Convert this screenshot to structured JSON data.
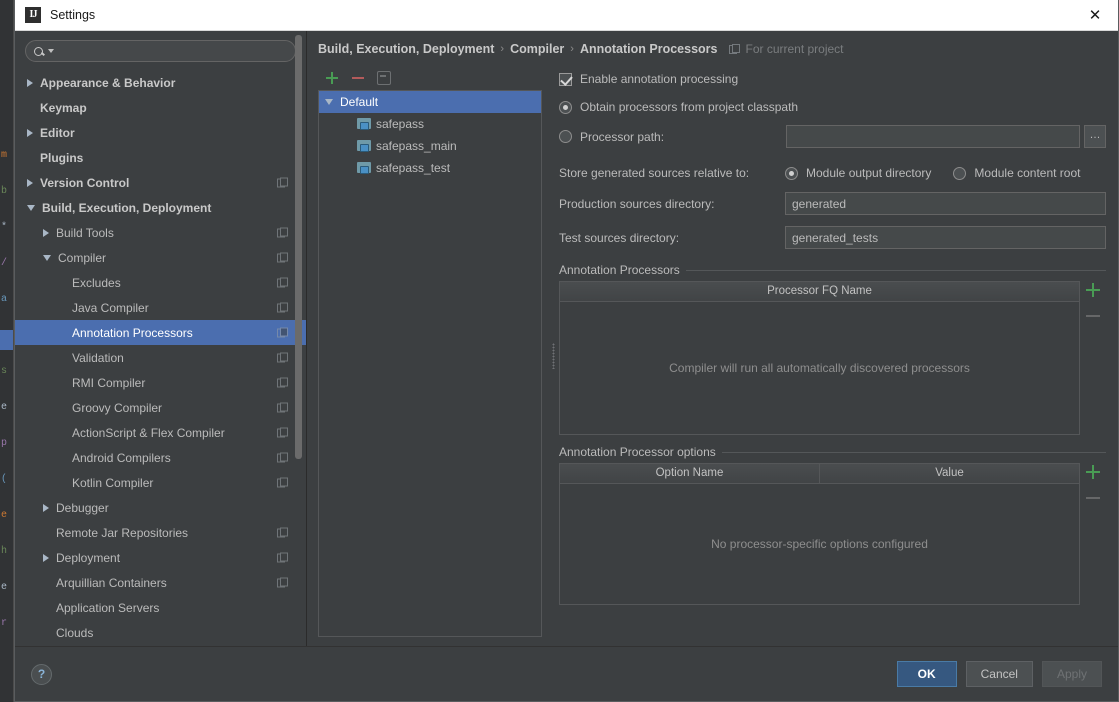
{
  "window": {
    "title": "Settings",
    "app_icon": "intellij-idea-icon",
    "close_icon": "close-icon"
  },
  "search": {
    "value": "",
    "placeholder": "",
    "icon": "search-icon"
  },
  "sidebar": {
    "items": [
      {
        "label": "Appearance & Behavior",
        "indent": 0,
        "arrow": "right",
        "bold": true,
        "selected": false,
        "project_badge": false
      },
      {
        "label": "Keymap",
        "indent": 0,
        "arrow": "none",
        "bold": true,
        "selected": false,
        "project_badge": false
      },
      {
        "label": "Editor",
        "indent": 0,
        "arrow": "right",
        "bold": true,
        "selected": false,
        "project_badge": false
      },
      {
        "label": "Plugins",
        "indent": 0,
        "arrow": "none",
        "bold": true,
        "selected": false,
        "project_badge": false
      },
      {
        "label": "Version Control",
        "indent": 0,
        "arrow": "right",
        "bold": true,
        "selected": false,
        "project_badge": true
      },
      {
        "label": "Build, Execution, Deployment",
        "indent": 0,
        "arrow": "down",
        "bold": true,
        "selected": false,
        "project_badge": false
      },
      {
        "label": "Build Tools",
        "indent": 1,
        "arrow": "right",
        "bold": false,
        "selected": false,
        "project_badge": true
      },
      {
        "label": "Compiler",
        "indent": 1,
        "arrow": "down",
        "bold": false,
        "selected": false,
        "project_badge": true
      },
      {
        "label": "Excludes",
        "indent": 2,
        "arrow": "none",
        "bold": false,
        "selected": false,
        "project_badge": true
      },
      {
        "label": "Java Compiler",
        "indent": 2,
        "arrow": "none",
        "bold": false,
        "selected": false,
        "project_badge": true
      },
      {
        "label": "Annotation Processors",
        "indent": 2,
        "arrow": "none",
        "bold": false,
        "selected": true,
        "project_badge": true
      },
      {
        "label": "Validation",
        "indent": 2,
        "arrow": "none",
        "bold": false,
        "selected": false,
        "project_badge": true
      },
      {
        "label": "RMI Compiler",
        "indent": 2,
        "arrow": "none",
        "bold": false,
        "selected": false,
        "project_badge": true
      },
      {
        "label": "Groovy Compiler",
        "indent": 2,
        "arrow": "none",
        "bold": false,
        "selected": false,
        "project_badge": true
      },
      {
        "label": "ActionScript & Flex Compiler",
        "indent": 2,
        "arrow": "none",
        "bold": false,
        "selected": false,
        "project_badge": true
      },
      {
        "label": "Android Compilers",
        "indent": 2,
        "arrow": "none",
        "bold": false,
        "selected": false,
        "project_badge": true
      },
      {
        "label": "Kotlin Compiler",
        "indent": 2,
        "arrow": "none",
        "bold": false,
        "selected": false,
        "project_badge": true
      },
      {
        "label": "Debugger",
        "indent": 1,
        "arrow": "right",
        "bold": false,
        "selected": false,
        "project_badge": false
      },
      {
        "label": "Remote Jar Repositories",
        "indent": 1,
        "arrow": "none",
        "bold": false,
        "selected": false,
        "project_badge": true
      },
      {
        "label": "Deployment",
        "indent": 1,
        "arrow": "right",
        "bold": false,
        "selected": false,
        "project_badge": true
      },
      {
        "label": "Arquillian Containers",
        "indent": 1,
        "arrow": "none",
        "bold": false,
        "selected": false,
        "project_badge": true
      },
      {
        "label": "Application Servers",
        "indent": 1,
        "arrow": "none",
        "bold": false,
        "selected": false,
        "project_badge": false
      },
      {
        "label": "Clouds",
        "indent": 1,
        "arrow": "none",
        "bold": false,
        "selected": false,
        "project_badge": false
      }
    ]
  },
  "breadcrumb": {
    "parts": [
      "Build, Execution, Deployment",
      "Compiler",
      "Annotation Processors"
    ],
    "separator": "›",
    "scope_label": "For current project",
    "scope_icon": "project-scope-icon"
  },
  "profiles": {
    "toolbar": [
      {
        "name": "add-profile-button",
        "icon": "plus-icon"
      },
      {
        "name": "remove-profile-button",
        "icon": "minus-icon"
      },
      {
        "name": "move-to-profile-button",
        "icon": "move-icon"
      }
    ],
    "rows": [
      {
        "label": "Default",
        "type": "profile",
        "selected": true,
        "arrow": "down"
      },
      {
        "label": "safepass",
        "type": "module",
        "selected": false,
        "arrow": "none"
      },
      {
        "label": "safepass_main",
        "type": "module",
        "selected": false,
        "arrow": "none"
      },
      {
        "label": "safepass_test",
        "type": "module",
        "selected": false,
        "arrow": "none"
      }
    ]
  },
  "form": {
    "enable_annotation_processing": {
      "label": "Enable annotation processing",
      "checked": true
    },
    "obtain_from_classpath": {
      "label": "Obtain processors from project classpath",
      "checked": true
    },
    "processor_path": {
      "label": "Processor path:",
      "checked": false,
      "value": "",
      "browse_label": "…"
    },
    "store_relative_label": "Store generated sources relative to:",
    "store_options": [
      {
        "label": "Module output directory",
        "checked": true
      },
      {
        "label": "Module content root",
        "checked": false
      }
    ],
    "production_sources": {
      "label": "Production sources directory:",
      "value": "generated"
    },
    "test_sources": {
      "label": "Test sources directory:",
      "value": "generated_tests"
    },
    "processors_section": {
      "title": "Annotation Processors",
      "columns": [
        "Processor FQ Name"
      ],
      "empty_text": "Compiler will run all automatically discovered processors",
      "add_icon": "plus-icon",
      "remove_icon": "minus-icon"
    },
    "options_section": {
      "title": "Annotation Processor options",
      "columns": [
        "Option Name",
        "Value"
      ],
      "empty_text": "No processor-specific options configured",
      "add_icon": "plus-icon",
      "remove_icon": "minus-icon"
    }
  },
  "footer": {
    "help_label": "?",
    "ok_label": "OK",
    "cancel_label": "Cancel",
    "apply_label": "Apply"
  },
  "colors": {
    "dialog_bg": "#3c3f41",
    "selection_blue": "#4b6eaf",
    "primary_button": "#365880",
    "accent_green": "#499c54",
    "accent_red": "#b35b5b",
    "text": "#bbbbbb"
  },
  "background_editor": {
    "gutter_chars": [
      "m",
      "b",
      "*",
      "/",
      "a",
      "e",
      "s",
      "e",
      "p",
      "(",
      "e",
      "h",
      "e",
      "r"
    ]
  }
}
